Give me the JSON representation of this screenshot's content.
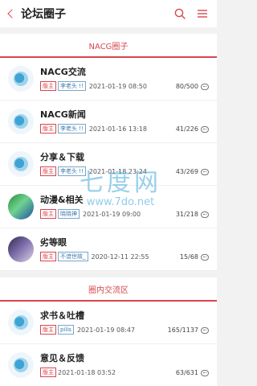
{
  "header": {
    "title": "论坛圈子"
  },
  "sections": [
    {
      "title": "NACG圈子",
      "items": [
        {
          "name": "NACG交流",
          "badge": "版主",
          "user": "李老头 !!",
          "date": "2021-01-19 08:50",
          "counts": "80/500",
          "avatar": "logo"
        },
        {
          "name": "NACG新闻",
          "badge": "版主",
          "user": "李老头 !!",
          "date": "2021-01-16 13:18",
          "counts": "41/226",
          "avatar": "logo"
        },
        {
          "name": "分享＆下载",
          "badge": "版主",
          "user": "李老头 !!",
          "date": "2021-01-18 23:24",
          "counts": "43/269",
          "avatar": "logo"
        },
        {
          "name": "动漫&相关",
          "badge": "版主",
          "user": "晓晓神",
          "date": "2021-01-19 09:00",
          "counts": "31/218",
          "avatar": "anime"
        },
        {
          "name": "劣等眼",
          "badge": "版主",
          "user": "不谙世故_",
          "date": "2020-12-11 22:55",
          "counts": "15/68",
          "avatar": "dark"
        }
      ]
    },
    {
      "title": "圈内交流区",
      "items": [
        {
          "name": "求书＆吐槽",
          "badge": "版主",
          "user": "pilis",
          "date": "2021-01-19 08:47",
          "counts": "165/1137",
          "avatar": "logo"
        },
        {
          "name": "意见＆反馈",
          "badge": "版主",
          "user": "",
          "date": "2021-01-18 03:52",
          "counts": "63/631",
          "avatar": "logo"
        }
      ]
    }
  ],
  "watermark": {
    "text": "七度网",
    "url": "www.7do.net"
  },
  "colors": {
    "accent": "#d8464e",
    "user_badge": "#3b78ab"
  }
}
